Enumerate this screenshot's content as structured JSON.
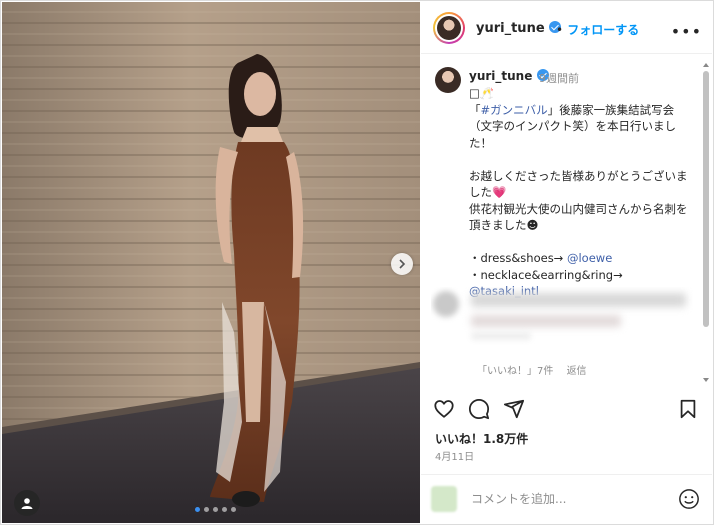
{
  "header": {
    "username": "yuri_tune",
    "separator": "•",
    "follow_label": "フォローする",
    "more_label": "•••"
  },
  "post": {
    "username": "yuri_tune",
    "time": "9週間前",
    "caption_lines": [
      "□🥂",
      "「#ガンニバル」後藤家一族集結試写会（文字のインパクト笑）を本日行いました！",
      "",
      "お越しくださった皆様ありがとうございました💗",
      "供花村観光大使の山内健司さんから名刺を頂きました☻",
      "",
      "・dress&shoes→ @loewe",
      "・necklace&earring&ring→ @tasaki_intl"
    ],
    "hashtag": "#ガンニバル",
    "mention_1": "@loewe",
    "mention_2": "@tasaki_intl"
  },
  "comment_meta": {
    "likes": "「いいね！」7件",
    "reply": "返信"
  },
  "engagement": {
    "likes_text": "いいね！1.8万件",
    "date": "4月11日"
  },
  "add_comment": {
    "placeholder": "コメントを追加..."
  },
  "carousel": {
    "slide_count": 5,
    "active_index": 0
  },
  "colors": {
    "link": "#3e5fa8",
    "follow": "#0095f6",
    "active_dot": "#3b90f0"
  }
}
